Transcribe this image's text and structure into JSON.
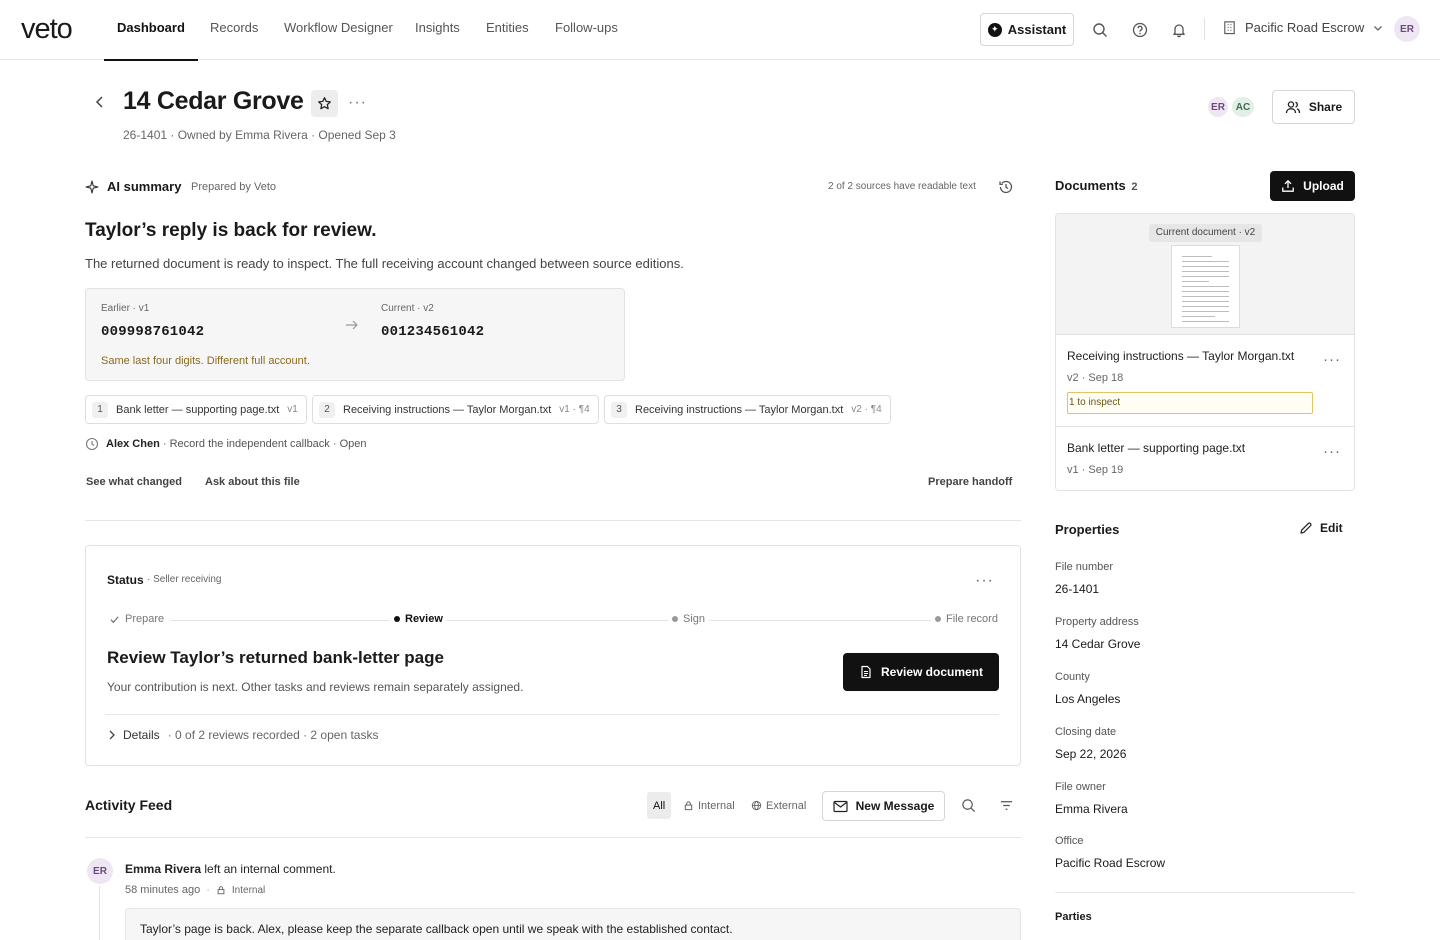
{
  "app": {
    "logo": "veto"
  },
  "nav": {
    "tabs": [
      {
        "label": "Dashboard",
        "active": true
      },
      {
        "label": "Records"
      },
      {
        "label": "Workflow Designer"
      },
      {
        "label": "Insights"
      },
      {
        "label": "Entities"
      },
      {
        "label": "Follow-ups"
      }
    ],
    "assistant_label": "Assistant",
    "org_name": "Pacific Road Escrow",
    "user_initials": "ER"
  },
  "header": {
    "title": "14 Cedar Grove",
    "meta": "26-1401 · Owned by Emma Rivera · Opened Sep 3",
    "collaborators": [
      "ER",
      "AC"
    ],
    "share_label": "Share"
  },
  "ai_summary": {
    "label": "AI summary",
    "prepared_by": "Prepared by Veto",
    "sources_note": "2 of 2 sources have readable text",
    "headline": "Taylor’s reply is back for review.",
    "body": "The returned document is ready to inspect. The full receiving account changed between source editions.",
    "comparison": {
      "earlier_label": "Earlier · v1",
      "earlier_value": "009998761042",
      "current_label": "Current · v2",
      "current_value": "001234561042",
      "note": "Same last four digits. Different full account."
    },
    "sources": [
      {
        "num": "1",
        "name": "Bank letter — supporting page.txt",
        "ver": "v1"
      },
      {
        "num": "2",
        "name": "Receiving instructions — Taylor Morgan.txt",
        "ver": "v1 · ¶4"
      },
      {
        "num": "3",
        "name": "Receiving instructions — Taylor Morgan.txt",
        "ver": "v2 · ¶4"
      }
    ],
    "task_assignee": "Alex Chen",
    "task_text": "· Record the independent callback · Open",
    "actions": {
      "see_changes": "See what changed",
      "ask": "Ask about this file",
      "handoff": "Prepare handoff"
    }
  },
  "status": {
    "label": "Status",
    "sub": "· Seller receiving",
    "steps": [
      {
        "label": "Prepare",
        "state": "done"
      },
      {
        "label": "Review",
        "state": "active"
      },
      {
        "label": "Sign",
        "state": "pending"
      },
      {
        "label": "File record",
        "state": "pending"
      }
    ],
    "task_title": "Review Taylor’s returned bank-letter page",
    "task_desc": "Your contribution is next. Other tasks and reviews remain separately assigned.",
    "review_button": "Review document",
    "details_label": "Details",
    "details_meta": "· 0 of 2 reviews recorded · 2 open tasks"
  },
  "activity": {
    "title": "Activity Feed",
    "filters": [
      "All",
      "Internal",
      "External"
    ],
    "new_message": "New Message",
    "entries": [
      {
        "initials": "ER",
        "author": "Emma Rivera",
        "action": "left an internal comment.",
        "time": "58 minutes ago",
        "visibility": "Internal",
        "text": "Taylor’s page is back. Alex, please keep the separate callback open until we speak with the established contact."
      }
    ]
  },
  "documents": {
    "title": "Documents",
    "count": "2",
    "upload_label": "Upload",
    "preview_label": "Current document · v2",
    "items": [
      {
        "name": "Receiving instructions — Taylor Morgan.txt",
        "meta": "v2 · Sep 18",
        "tag": "1 to inspect"
      },
      {
        "name": "Bank letter — supporting page.txt",
        "meta": "v1 · Sep 19"
      }
    ]
  },
  "properties": {
    "title": "Properties",
    "edit_label": "Edit",
    "fields": [
      {
        "label": "File number",
        "value": "26-1401"
      },
      {
        "label": "Property address",
        "value": "14 Cedar Grove"
      },
      {
        "label": "County",
        "value": "Los Angeles"
      },
      {
        "label": "Closing date",
        "value": "Sep 22, 2026"
      },
      {
        "label": "File owner",
        "value": "Emma Rivera"
      },
      {
        "label": "Office",
        "value": "Pacific Road Escrow"
      }
    ],
    "parties_title": "Parties"
  }
}
